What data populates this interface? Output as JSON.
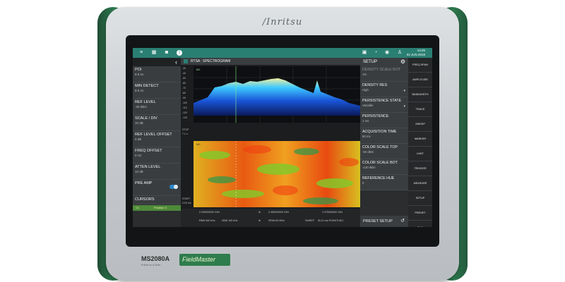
{
  "device": {
    "brand": "/Inritsu",
    "model": "MS2080A",
    "model_sub": "9 kHz to 4 GHz",
    "product_line": "FieldMaster"
  },
  "topbar": {
    "icons": [
      "menu-icon",
      "grid-icon",
      "camera-icon",
      "info-icon",
      "screen-icon",
      "wifi-icon",
      "gps-icon",
      "user-icon"
    ],
    "time": "14:25",
    "date": "02 JUN 2018"
  },
  "left_panel": {
    "items": [
      {
        "label": "POI",
        "value": "8.9 ns"
      },
      {
        "label": "MIN DETECT",
        "value": "8.9 ns"
      },
      {
        "label": "REF LEVEL",
        "value": "-30 dBm"
      },
      {
        "label": "SCALE / DIV",
        "value": "10 dB"
      },
      {
        "label": "REF LEVEL OFFSET",
        "value": "0 dB"
      },
      {
        "label": "FREQ OFFSET",
        "value": "0 Hz"
      },
      {
        "label": "ATTEN LEVEL",
        "value": "10 dB"
      },
      {
        "label": "PRE AMP",
        "value": ""
      },
      {
        "label": "CURSORS",
        "value": ""
      }
    ],
    "cursor": {
      "name": "C1",
      "position": "Position 3"
    }
  },
  "center": {
    "title": "RTSA : SPECTROGRAM",
    "marker1": "M1",
    "marker2": "M2",
    "y_labels": [
      "-30",
      "-40",
      "-50",
      "-60",
      "-70",
      "-80",
      "-90",
      "-100",
      "-110",
      "-120",
      "-130"
    ],
    "stop_label": "STOP",
    "stop_value": "7.1 s",
    "start_label": "START",
    "start_value": "0.00 ms",
    "freq_left": "2.425000000 GHz",
    "freq_mid": "2.450000000 GHz",
    "freq_right": "2.475000000 GHz",
    "rbw": "RBW 500 kHz",
    "vbw": "VBW 100 kHz",
    "span": "SPAN 50 MHz",
    "sweep": "SWEEP",
    "points": "50.01 ms  POINTS 601"
  },
  "setup": {
    "title": "SETUP",
    "items": [
      {
        "label": "DENSITY SCALE BOT",
        "value": "1%",
        "dim": true,
        "dropdown": false
      },
      {
        "label": "DENSITY RES",
        "value": "High",
        "dim": false,
        "dropdown": true
      },
      {
        "label": "PERSISTENCE STATE",
        "value": "Variable",
        "dim": false,
        "dropdown": true
      },
      {
        "label": "PERSISTENCE",
        "value": "1 ms",
        "dim": false,
        "dropdown": false
      },
      {
        "label": "ACQUISITION TIME",
        "value": "50 ms",
        "dim": false,
        "dropdown": false
      },
      {
        "label": "COLOR SCALE TOP",
        "value": "-50 dBm",
        "dim": false,
        "dropdown": false
      },
      {
        "label": "COLOR SCALE BOT",
        "value": "-130 dBm",
        "dim": false,
        "dropdown": false
      },
      {
        "label": "REFERENCE HUE",
        "value": "0",
        "dim": false,
        "dropdown": false
      }
    ],
    "preset": "PRESET SETUP"
  },
  "right_menu": [
    "FREQ SPAN",
    "AMPLITUDE",
    "BANDWIDTH",
    "TRACE",
    "SWEEP",
    "MARKER",
    "LIMIT",
    "TRIGGER",
    "MEASURE",
    "SETUP",
    "PRESET",
    "FILE"
  ]
}
